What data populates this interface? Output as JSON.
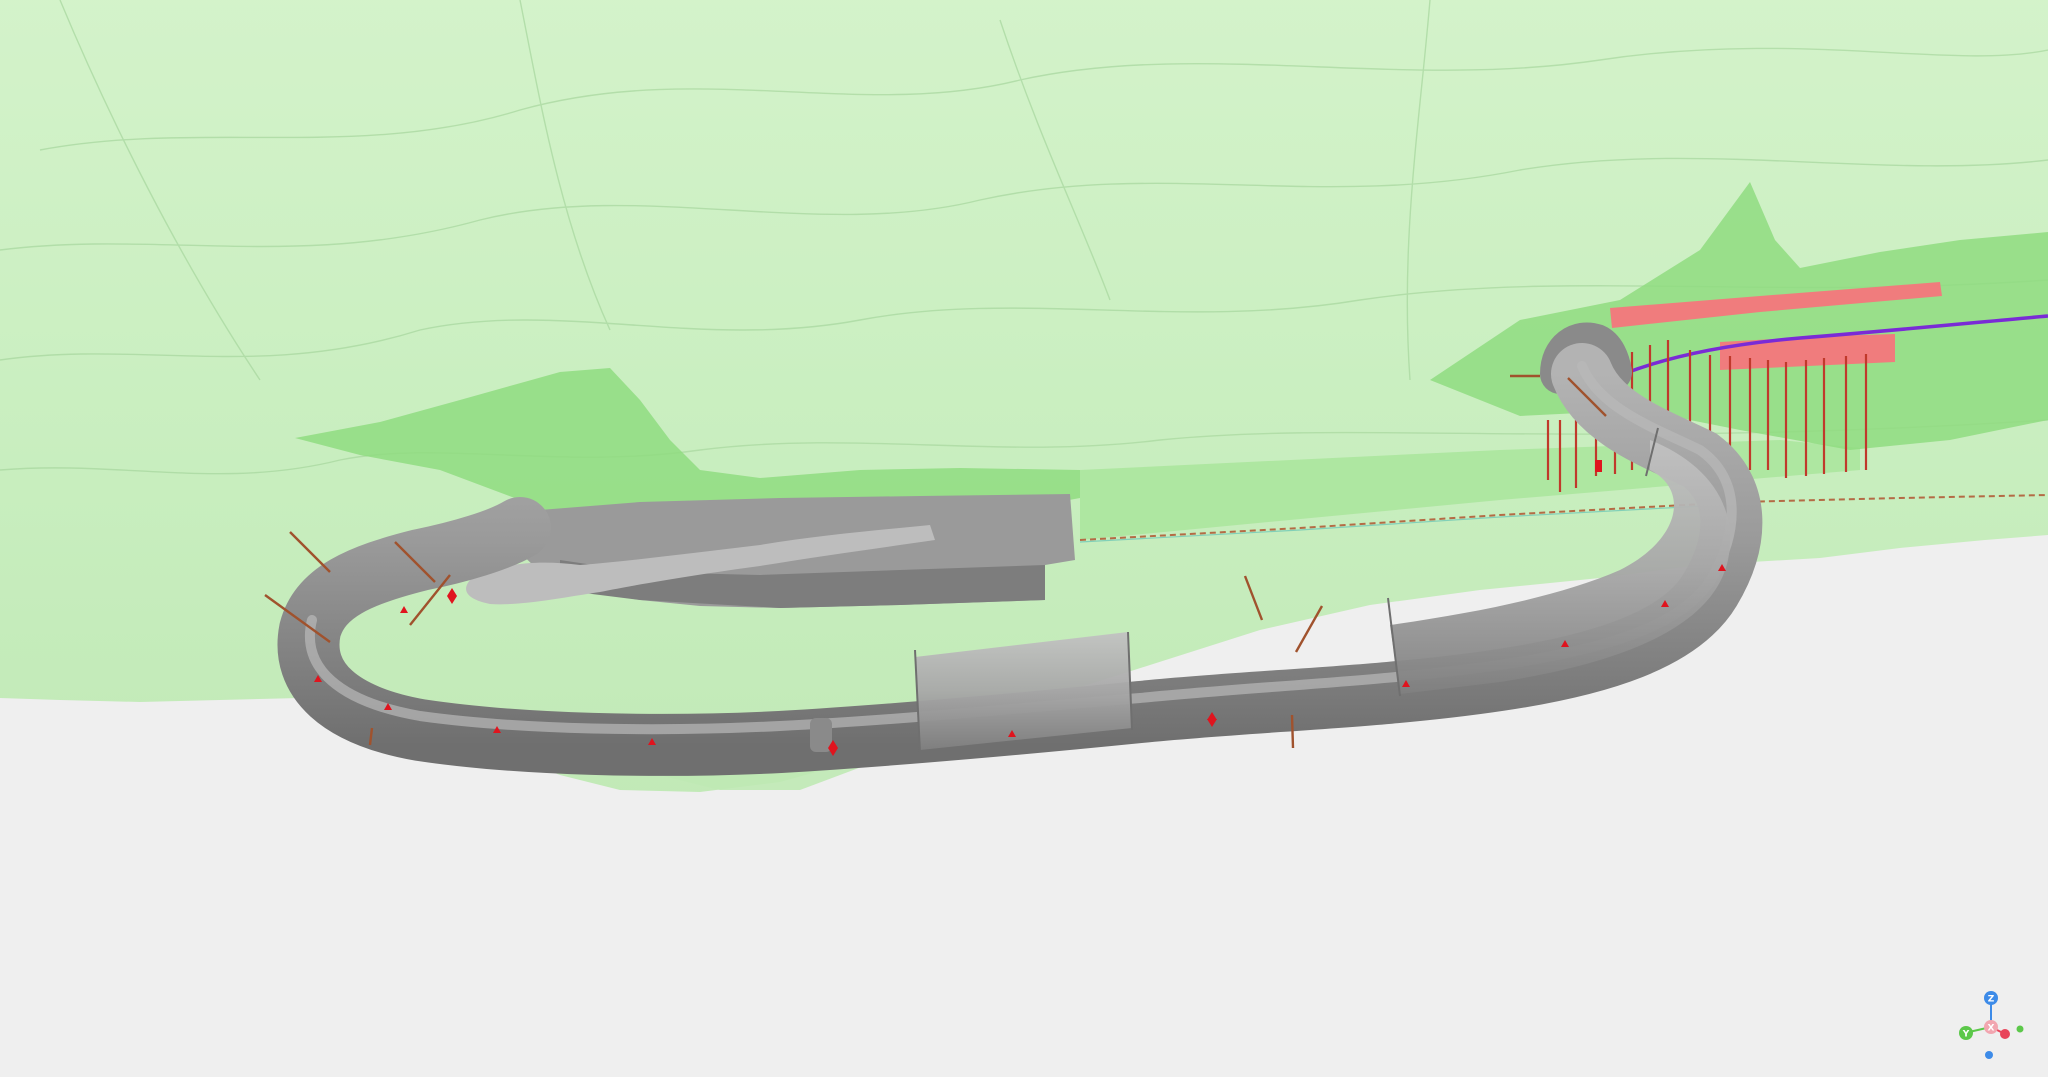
{
  "viewer": {
    "background_color": "#efefef",
    "terrain_color": "#c9f0c0",
    "terrain_dark_color": "#8fdc80",
    "tunnel_color": "#9c9c9c",
    "tunnel_dark_color": "#7a7a7a",
    "borehole_color": "#a0522d",
    "marker_color": "#e0141e",
    "highlight_color": "#ff6b7a",
    "alignment_color": "#7a2bd6"
  },
  "axis_gizmo": {
    "z_label": "Z",
    "y_label": "Y",
    "x_label": "X",
    "z_color": "#3d8be8",
    "y_color": "#5cc84a",
    "x_color": "#e8445a",
    "origin_color": "#f2a6b0"
  }
}
